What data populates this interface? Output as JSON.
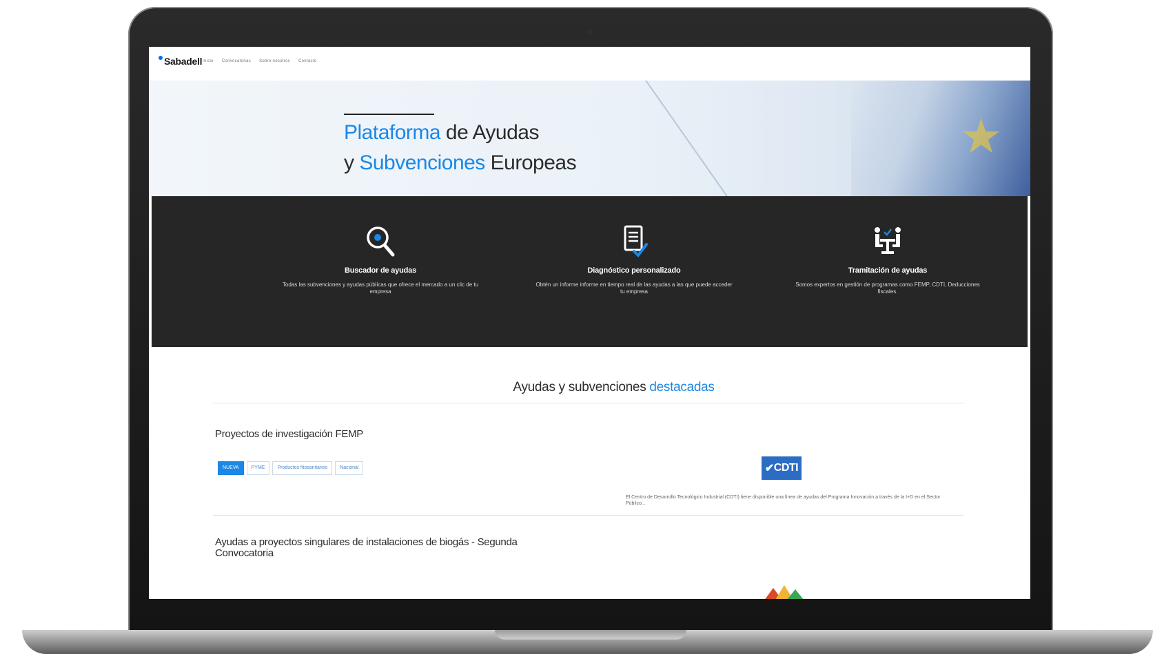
{
  "nav": {
    "logo": "Sabadell",
    "links": [
      "Inicio",
      "Convocatorias",
      "Sobre nosotros",
      "Contacto"
    ]
  },
  "hero": {
    "line1_highlight": "Plataforma",
    "line1_rest": " de Ayudas",
    "line2_start": "y ",
    "line2_highlight": "Subvenciones",
    "line2_rest": " Europeas"
  },
  "features": [
    {
      "icon": "search-icon",
      "title": "Buscador de ayudas",
      "desc": "Todas las subvenciones y ayudas públicas que ofrece el mercado a un clic de tu empresa"
    },
    {
      "icon": "document-check-icon",
      "title": "Diagnóstico personalizado",
      "desc": "Obtén un informe informe en tiempo real de las ayudas a las que puede acceder tu empresa"
    },
    {
      "icon": "meeting-icon",
      "title": "Tramitación de ayudas",
      "desc": "Somos expertos en gestión de programas como FEMP, CDTI, Deducciones fiscales."
    }
  ],
  "featured": {
    "title_start": "Ayudas y subvenciones ",
    "title_highlight": "destacadas",
    "cards": [
      {
        "title": "Proyectos de investigación FEMP",
        "tags": [
          "NUEVA",
          "PYME",
          "Productos fitosanitarios",
          "Nacional"
        ],
        "logo_text": "CDTI",
        "desc": "El Centro de Desarrollo Tecnológico Industrial (CDTI) tiene disponible una línea de ayudas del Programa Innovación a través de la I+D en el Sector Público..."
      },
      {
        "title": "Ayudas a proyectos singulares de instalaciones de biogás - Segunda Convocatoria"
      }
    ]
  },
  "colors": {
    "accent": "#1b87e6",
    "band": "#262626"
  }
}
